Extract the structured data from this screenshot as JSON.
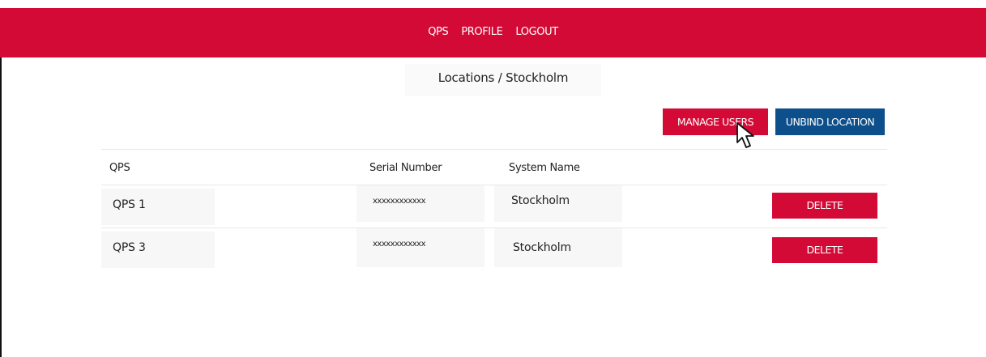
{
  "nav": {
    "items": [
      "QPS",
      "PROFILE",
      "LOGOUT"
    ]
  },
  "breadcrumb": "Locations / Stockholm",
  "actions": {
    "manage_users": "MANAGE USERS",
    "unbind_location": "UNBIND LOCATION"
  },
  "table": {
    "headers": [
      "QPS",
      "Serial Number",
      "System Name"
    ],
    "rows": [
      {
        "qps": "QPS 1",
        "serial": "xxxxxxxxxxxx",
        "system": "Stockholm",
        "action": "DELETE"
      },
      {
        "qps": "QPS 3",
        "serial": "xxxxxxxxxxxx",
        "system": "Stockholm",
        "action": "DELETE"
      }
    ]
  },
  "colors": {
    "brand_red": "#d30a35",
    "brand_blue": "#0d4f8b"
  }
}
